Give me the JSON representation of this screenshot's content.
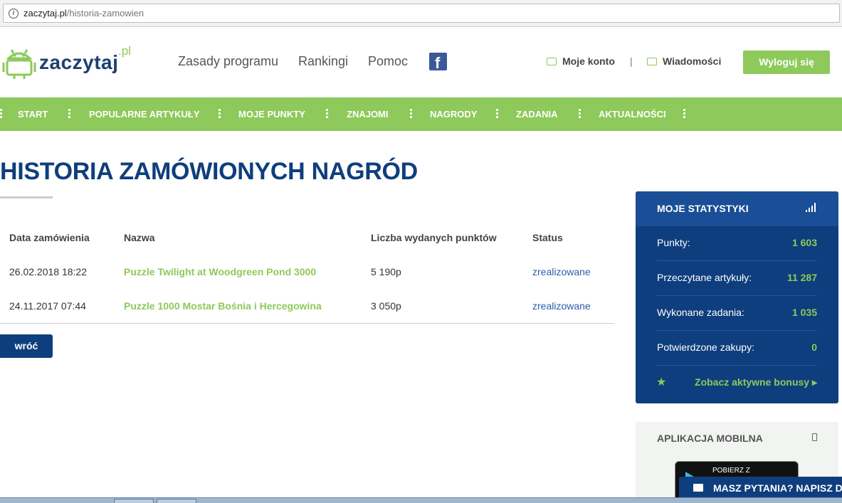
{
  "browser": {
    "url_domain": "zaczytaj.pl",
    "url_path": "/historia-zamowien"
  },
  "header": {
    "logo_text": "zaczytaj",
    "logo_suffix": ".pl",
    "links": [
      "Zasady programu",
      "Rankingi",
      "Pomoc"
    ],
    "account_label": "Moje konto",
    "separator": "|",
    "messages_label": "Wiadomości",
    "logout_label": "Wyloguj się"
  },
  "nav": {
    "items": [
      "START",
      "POPULARNE ARTYKUŁY",
      "MOJE PUNKTY",
      "ZNAJOMI",
      "NAGRODY",
      "ZADANIA",
      "AKTUALNOŚCI"
    ]
  },
  "page": {
    "title": "HISTORIA ZAMÓWIONYCH NAGRÓD",
    "back_label": "wróć"
  },
  "orders": {
    "columns": [
      "Data zamówienia",
      "Nazwa",
      "Liczba wydanych punktów",
      "Status"
    ],
    "rows": [
      {
        "date": "26.02.2018 18:22",
        "name": "Puzzle Twilight at Woodgreen Pond 3000",
        "points": "5 190p",
        "status": "zrealizowane"
      },
      {
        "date": "24.11.2017 07:44",
        "name": "Puzzle 1000 Mostar Bośnia i Hercegowina",
        "points": "3 050p",
        "status": "zrealizowane"
      }
    ]
  },
  "stats": {
    "title": "MOJE STATYSTYKI",
    "rows": [
      {
        "label": "Punkty:",
        "value": "1 603"
      },
      {
        "label": "Przeczytane artykuły:",
        "value": "11 287"
      },
      {
        "label": "Wykonane zadania:",
        "value": "1 035"
      },
      {
        "label": "Potwierdzone zakupy:",
        "value": "0"
      }
    ],
    "bonus_link": "Zobacz aktywne bonusy"
  },
  "mobile": {
    "title": "APLIKACJA MOBILNA",
    "badge_text": "POBIERZ Z"
  },
  "chat": {
    "label": "MASZ PYTANIA? NAPISZ D"
  },
  "colors": {
    "brand_green": "#8ec95b",
    "brand_navy": "#0e3e7d"
  }
}
